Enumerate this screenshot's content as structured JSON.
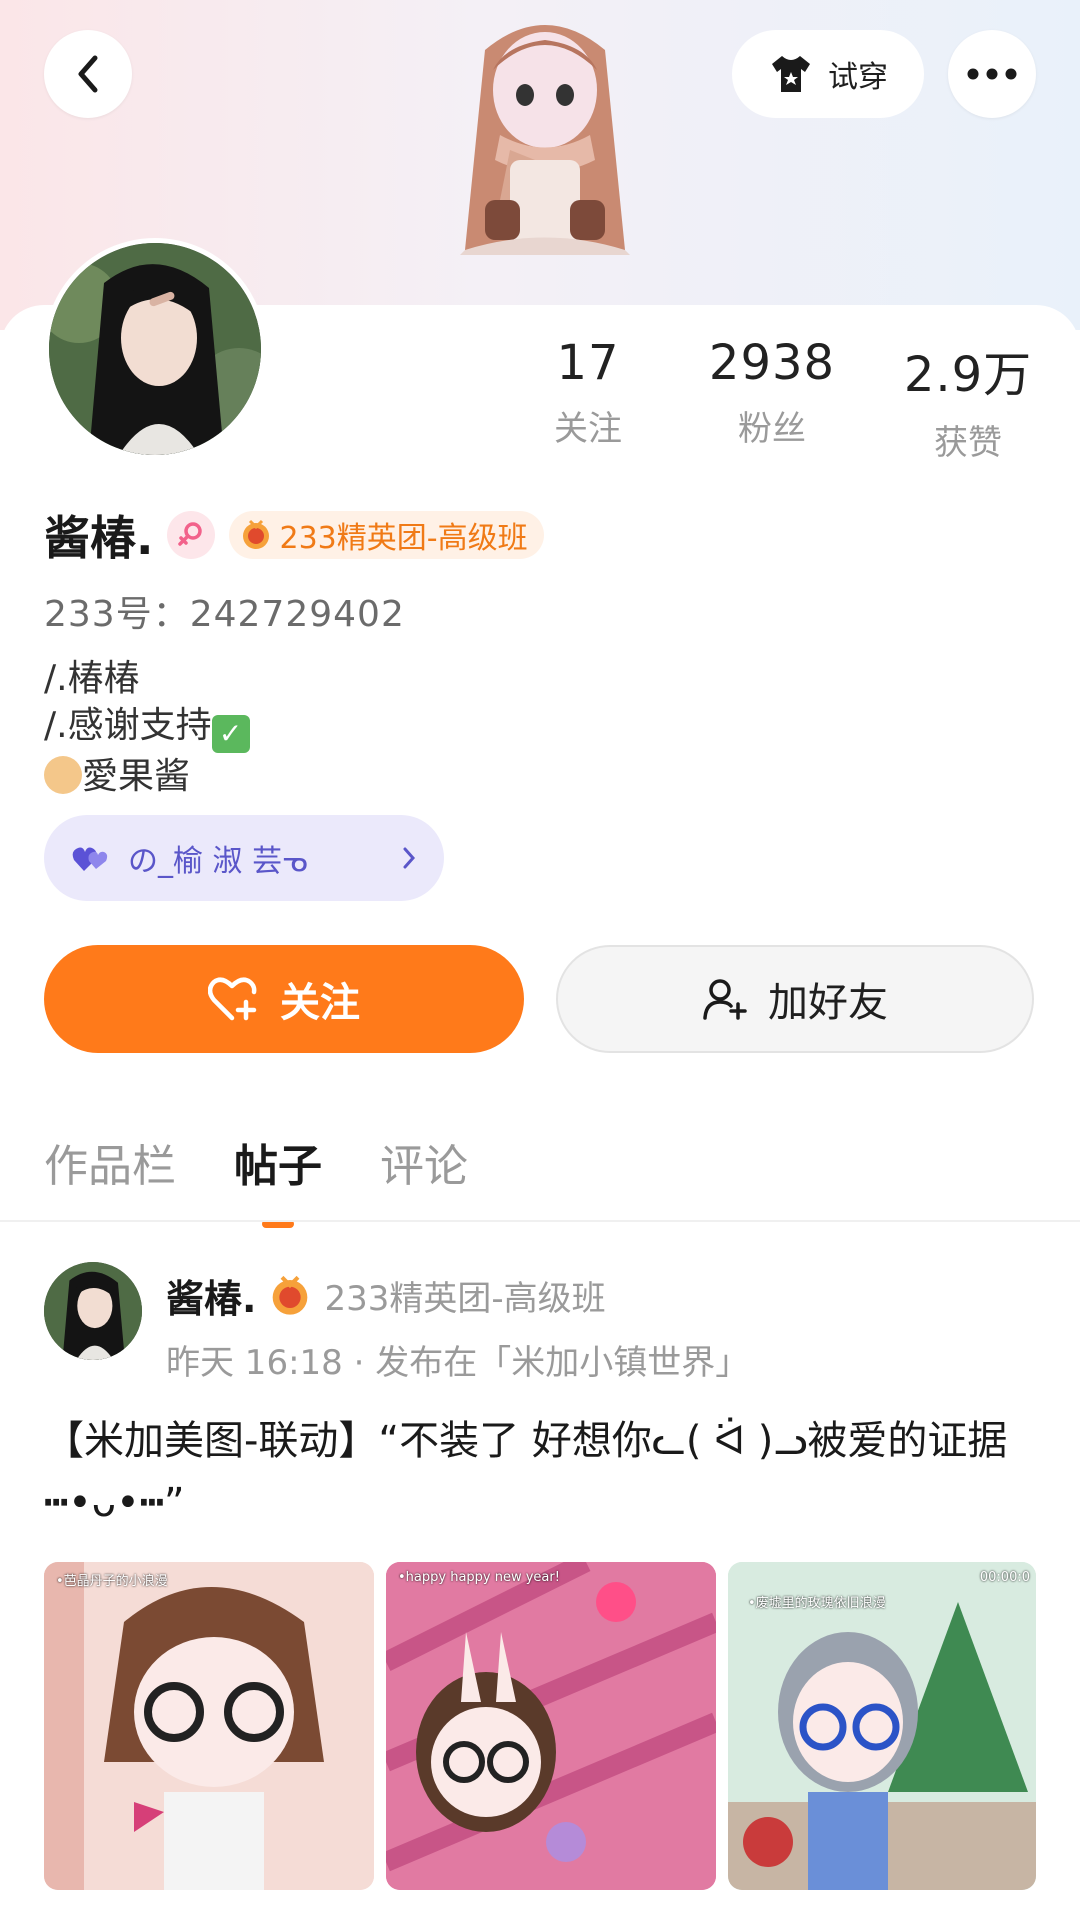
{
  "header": {
    "tryon_label": "试穿"
  },
  "stats": [
    {
      "value": "17",
      "label": "关注"
    },
    {
      "value": "2938",
      "label": "粉丝"
    },
    {
      "value": "2.9万",
      "label": "获赞"
    }
  ],
  "profile": {
    "name": "酱椿.",
    "badge": "233精英团-高级班",
    "uid": "233号：242729402",
    "bio": [
      "/.椿椿",
      "/.感谢支持",
      "愛果酱"
    ],
    "cp_name": "の_榆 淑 芸ᓀ"
  },
  "actions": {
    "follow_label": "关注",
    "add_friend_label": "加好友"
  },
  "tabs": [
    {
      "label": "作品栏",
      "active": false
    },
    {
      "label": "帖子",
      "active": true
    },
    {
      "label": "评论",
      "active": false
    }
  ],
  "post": {
    "author": "酱椿.",
    "badge": "233精英团-高级班",
    "meta": "昨天 16:18 · 发布在「米加小镇世界」",
    "text": "【米加美图-联动】“不装了 好想你ᓚ( ᐛ )ᓗ被爱的证据┅•ᴗ•┅”",
    "thumb_captions": [
      "•芭晶丹子的小浪漫",
      "•happy happy new year!",
      "•废墟里的玫瑰依旧浪漫",
      "00:00:0"
    ]
  },
  "colors": {
    "accent": "#ff7a1a",
    "cp_pill": "#ebe9fb"
  }
}
